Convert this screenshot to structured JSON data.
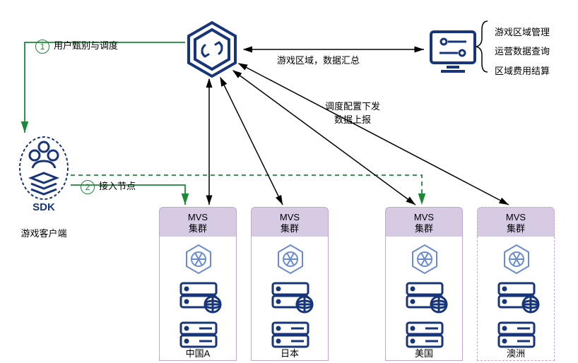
{
  "colors": {
    "primary": "#17357a",
    "accent": "#1a8a38",
    "black": "#000",
    "lilac": "#d6cbe3"
  },
  "center": {
    "label_left": "游戏区域",
    "label_right": "数据汇总"
  },
  "dashboard": {
    "items": [
      "游戏区域管理",
      "运营数据查询",
      "区域费用结算"
    ]
  },
  "sdk": {
    "caption": "游戏客户端",
    "text": "SDK"
  },
  "steps": {
    "one": {
      "num": "1",
      "text": "用户甄别与调度"
    },
    "two": {
      "num": "2",
      "text": "接入节点"
    }
  },
  "dispatch": {
    "line1": "调度配置下发",
    "line2": "数据上报"
  },
  "cluster_label": {
    "line1": "MVS",
    "line2": "集群"
  },
  "regions": [
    "中国A",
    "日本",
    "美国",
    "澳洲"
  ]
}
